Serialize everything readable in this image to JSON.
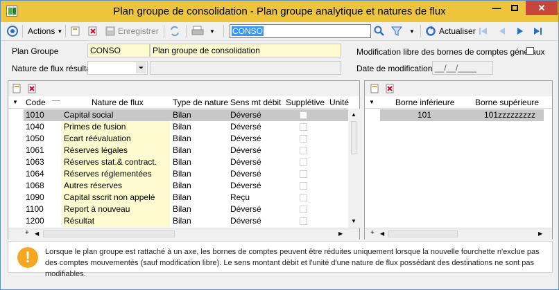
{
  "window": {
    "title": "Plan groupe de consolidation -  Plan groupe analytique et natures de flux"
  },
  "toolbar": {
    "actions_label": "Actions",
    "save_label": "Enregistrer",
    "search_value": "CONSO",
    "refresh_label": "Actualiser"
  },
  "form": {
    "plan_groupe_label": "Plan Groupe",
    "plan_groupe_code": "CONSO",
    "plan_groupe_name": "Plan groupe de consolidation",
    "nature_label": "Nature de flux résultat",
    "modif_libre_label": "Modification libre des bornes de comptes généraux",
    "date_modif_label": "Date de modification",
    "date_modif_value": "__/__/____"
  },
  "left_table": {
    "headers": [
      "Code",
      "Nature de flux",
      "Type de nature",
      "Sens mt débit",
      "Supplétive",
      "Unité"
    ],
    "rows": [
      {
        "code": "1010",
        "nature": "Capital social",
        "type": "Bilan",
        "sens": "Déversé"
      },
      {
        "code": "1040",
        "nature": "Primes de fusion",
        "type": "Bilan",
        "sens": "Déversé"
      },
      {
        "code": "1050",
        "nature": "Ecart réévaluation",
        "type": "Bilan",
        "sens": "Déversé"
      },
      {
        "code": "1061",
        "nature": "Réserves légales",
        "type": "Bilan",
        "sens": "Déversé"
      },
      {
        "code": "1063",
        "nature": "Réserves stat.& contract.",
        "type": "Bilan",
        "sens": "Déversé"
      },
      {
        "code": "1064",
        "nature": "Réserves réglementées",
        "type": "Bilan",
        "sens": "Déversé"
      },
      {
        "code": "1068",
        "nature": "Autres réserves",
        "type": "Bilan",
        "sens": "Déversé"
      },
      {
        "code": "1090",
        "nature": "Capital sscrit non appelé",
        "type": "Bilan",
        "sens": "Reçu"
      },
      {
        "code": "1100",
        "nature": "Report à nouveau",
        "type": "Bilan",
        "sens": "Déversé"
      },
      {
        "code": "1200",
        "nature": "Résultat",
        "type": "Bilan",
        "sens": "Déversé"
      }
    ]
  },
  "right_table": {
    "headers": [
      "Borne inférieure",
      "Borne supérieure"
    ],
    "rows": [
      {
        "inf": "101",
        "sup": "101zzzzzzzzz"
      }
    ]
  },
  "info": {
    "text": "Lorsque le plan groupe est rattaché à un axe, les bornes de comptes peuvent être réduites uniquement lorsque la nouvelle fourchette n'exclue pas des comptes mouvementés (sauf modification libre). Le sens montant débit et l'unité d'une nature de flux possédant des destinations ne sont pas modifiables."
  }
}
